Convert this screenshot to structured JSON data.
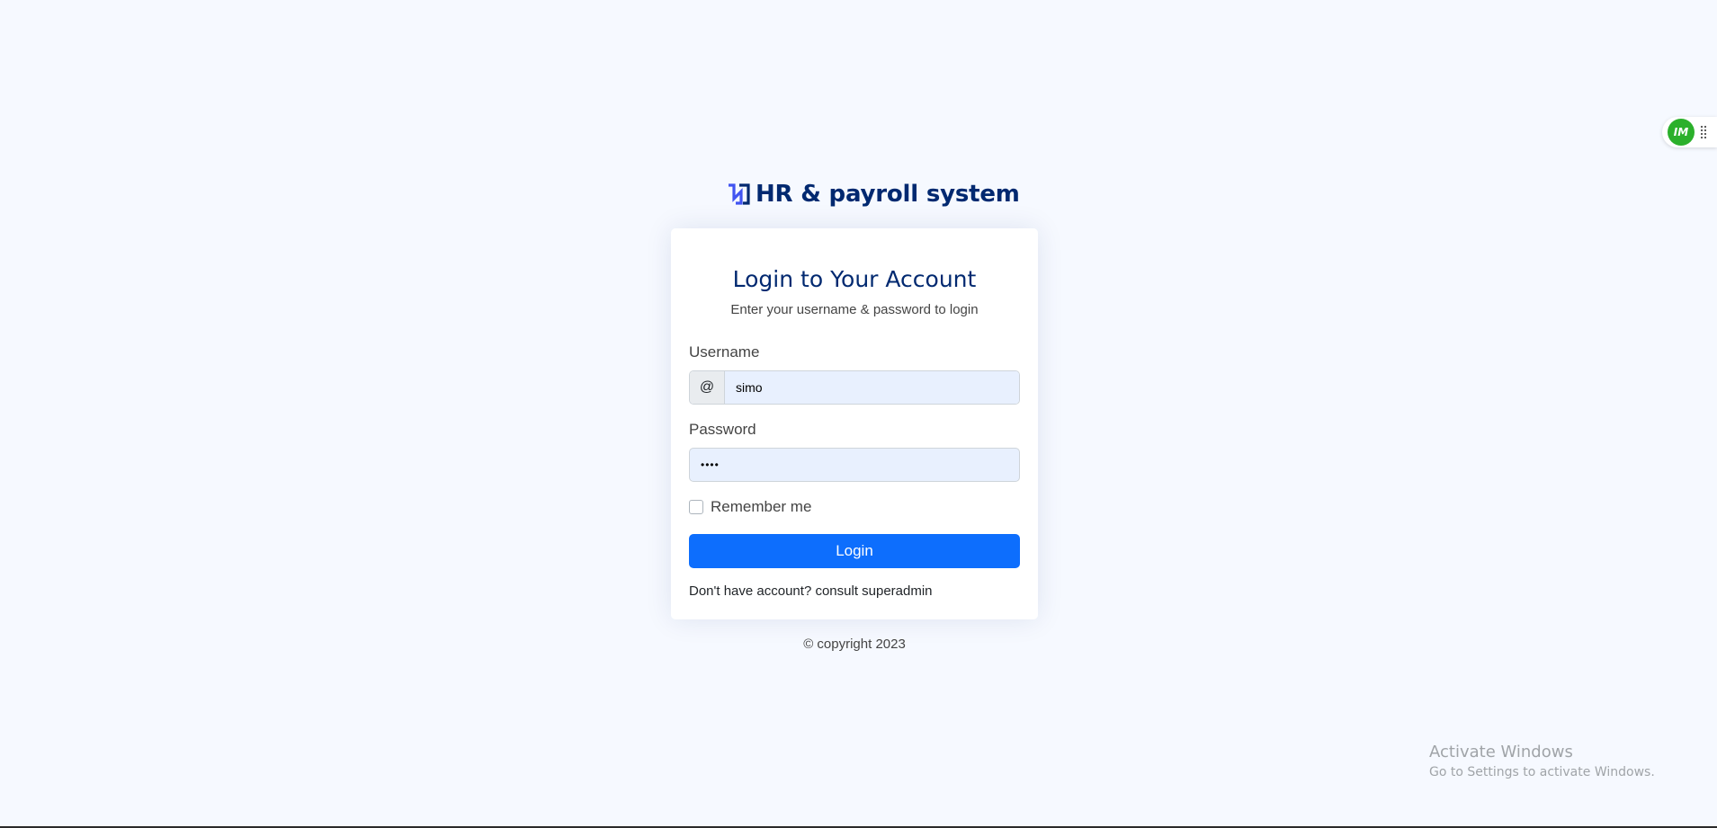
{
  "brand": {
    "title": "HR & payroll system",
    "logo_icon": "brand-logo-icon",
    "color": "#012970",
    "logo_color": "#4154f1"
  },
  "card": {
    "title": "Login to Your Account",
    "subtitle": "Enter your username & password to login",
    "username_label": "Username",
    "username_prefix": "@",
    "username_value": "simo",
    "password_label": "Password",
    "password_value": "••••",
    "remember_label": "Remember me",
    "remember_checked": false,
    "login_label": "Login",
    "signup_text": "Don't have account? consult superadmin"
  },
  "footer": {
    "copyright": "© copyright 2023"
  },
  "extension": {
    "badge": "IM",
    "icon": "extension-badge-icon",
    "color": "#2bb02b"
  },
  "watermark": {
    "title": "Activate Windows",
    "subtitle": "Go to Settings to activate Windows."
  },
  "colors": {
    "background": "#f6f9ff",
    "primary": "#0d6efd",
    "input_fill": "#e8f0fe"
  }
}
